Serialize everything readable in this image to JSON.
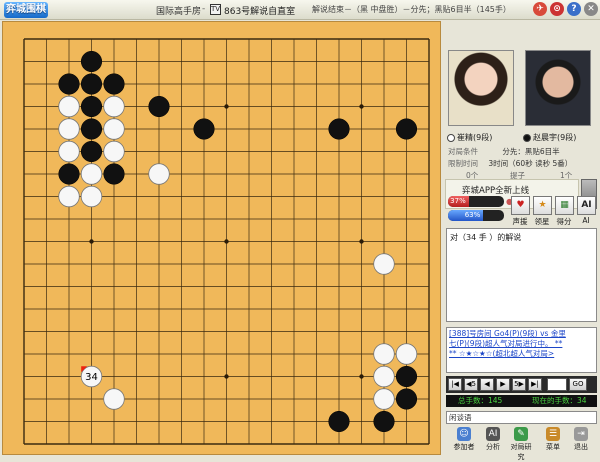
{
  "titlebar": {
    "logo": "弈城围棋",
    "room": "国际高手房",
    "sep": "-",
    "tv": "TV",
    "live_title": "863号解说自直室",
    "game_info": "解说结束－（黑 中盘胜）－分先；黑贴6目半（145手）"
  },
  "panel": {
    "player_white": "崔精(9段)",
    "player_black": "赵晨宇(9段)",
    "conditions_label": "对局条件",
    "conditions_value": "分先：黑贴6目半",
    "time_label": "限制时间",
    "time_value": "3时间（60秒 读秒 5番）",
    "white_captures": "0个",
    "captures_label": "提子",
    "black_captures": "1个",
    "ad_text": "弈城APP全新上线",
    "white_rate": "37%",
    "white_rate_value": 37,
    "black_rate": "63%",
    "black_rate_value": 63,
    "buttons": [
      "声援",
      "领星",
      "得分",
      "AI"
    ],
    "comment": "对（34 手 ）的解说",
    "chat": [
      "[388]号房间 Go4(P)(9段) vs 金里",
      "七(P)(9段)超人气对局进行中。 **",
      "** ☆★☆★☆(超北超人气对局>",
      ""
    ],
    "nav": [
      "|◀",
      "◀5",
      "◀",
      "▶",
      "5▶",
      "▶|",
      "GO"
    ],
    "total_moves": "总手数：145",
    "current_move": "现在的手数：34",
    "chat_input_label": "闲谈语",
    "bottom": [
      "参加者",
      "分析",
      "对局研究",
      "菜单",
      "退出"
    ]
  },
  "board": {
    "size": 19,
    "last_move_label": "34",
    "stones": [
      {
        "c": "b",
        "col": 3,
        "row": 1
      },
      {
        "c": "b",
        "col": 2,
        "row": 2
      },
      {
        "c": "b",
        "col": 3,
        "row": 2
      },
      {
        "c": "b",
        "col": 4,
        "row": 2
      },
      {
        "c": "w",
        "col": 2,
        "row": 3
      },
      {
        "c": "b",
        "col": 3,
        "row": 3
      },
      {
        "c": "w",
        "col": 4,
        "row": 3
      },
      {
        "c": "b",
        "col": 6,
        "row": 3
      },
      {
        "c": "w",
        "col": 2,
        "row": 4
      },
      {
        "c": "b",
        "col": 3,
        "row": 4
      },
      {
        "c": "w",
        "col": 4,
        "row": 4
      },
      {
        "c": "b",
        "col": 8,
        "row": 4
      },
      {
        "c": "b",
        "col": 14,
        "row": 4
      },
      {
        "c": "b",
        "col": 17,
        "row": 4
      },
      {
        "c": "w",
        "col": 2,
        "row": 5
      },
      {
        "c": "b",
        "col": 3,
        "row": 5
      },
      {
        "c": "w",
        "col": 4,
        "row": 5
      },
      {
        "c": "b",
        "col": 2,
        "row": 6
      },
      {
        "c": "w",
        "col": 3,
        "row": 6
      },
      {
        "c": "b",
        "col": 4,
        "row": 6
      },
      {
        "c": "w",
        "col": 6,
        "row": 6
      },
      {
        "c": "w",
        "col": 2,
        "row": 7
      },
      {
        "c": "w",
        "col": 3,
        "row": 7
      },
      {
        "c": "w",
        "col": 16,
        "row": 10
      },
      {
        "c": "w",
        "col": 16,
        "row": 14
      },
      {
        "c": "w",
        "col": 17,
        "row": 14
      },
      {
        "c": "w",
        "col": 3,
        "row": 15
      },
      {
        "c": "w",
        "col": 16,
        "row": 15
      },
      {
        "c": "b",
        "col": 17,
        "row": 15
      },
      {
        "c": "w",
        "col": 4,
        "row": 16
      },
      {
        "c": "b",
        "col": 17,
        "row": 16
      },
      {
        "c": "w",
        "col": 16,
        "row": 16
      },
      {
        "c": "b",
        "col": 14,
        "row": 17
      },
      {
        "c": "b",
        "col": 16,
        "row": 17
      }
    ],
    "last_move": {
      "c": "w",
      "col": 3,
      "row": 15
    }
  }
}
